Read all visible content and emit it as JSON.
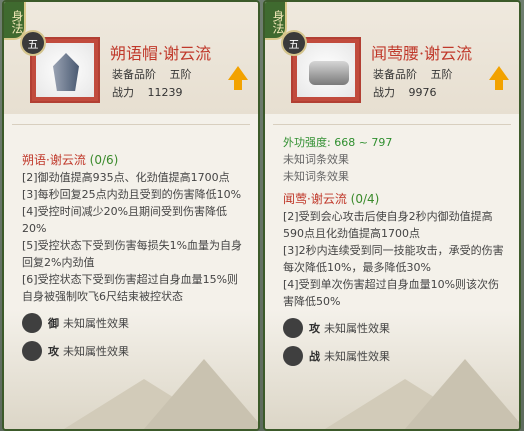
{
  "left": {
    "tag": "身法",
    "grade": "五",
    "title": "朔语帽·谢云流",
    "meta1": {
      "label": "装备品阶",
      "value": "五阶"
    },
    "meta2": {
      "label": "战力",
      "value": "11239"
    },
    "set_name": "朔语·谢云流",
    "set_count": "(0/6)",
    "lines": [
      "[2]御劲值提高935点、化劲值提高1700点",
      "[3]每秒回复25点内劲且受到的伤害降低10%",
      "[4]受控时间减少20%且期间受到伤害降低20%",
      "[5]受控状态下受到伤害每损失1%血量为自身回复2%内劲值",
      "[6]受控状态下受到伤害超过自身血量15%则自身被强制吹飞6尺结束被控状态"
    ],
    "effects": [
      {
        "char": "御",
        "text": "未知属性效果"
      },
      {
        "char": "攻",
        "text": "未知属性效果"
      }
    ]
  },
  "right": {
    "tag": "身法",
    "grade": "五",
    "title": "闻莺腰·谢云流",
    "meta1": {
      "label": "装备品阶",
      "value": "五阶"
    },
    "meta2": {
      "label": "战力",
      "value": "9976"
    },
    "stat": "外功强度: 668 ~ 797",
    "unknown1": "未知词条效果",
    "unknown2": "未知词条效果",
    "set_name": "闻莺·谢云流",
    "set_count": "(0/4)",
    "lines": [
      "[2]受到会心攻击后使自身2秒内御劲值提高590点且化劲值提高1700点",
      "[3]2秒内连续受到同一技能攻击，承受的伤害每次降低10%，最多降低30%",
      "[4]受到单次伤害超过自身血量10%则该次伤害降低50%"
    ],
    "effects": [
      {
        "char": "攻",
        "text": "未知属性效果"
      },
      {
        "char": "战",
        "text": "未知属性效果"
      }
    ]
  }
}
